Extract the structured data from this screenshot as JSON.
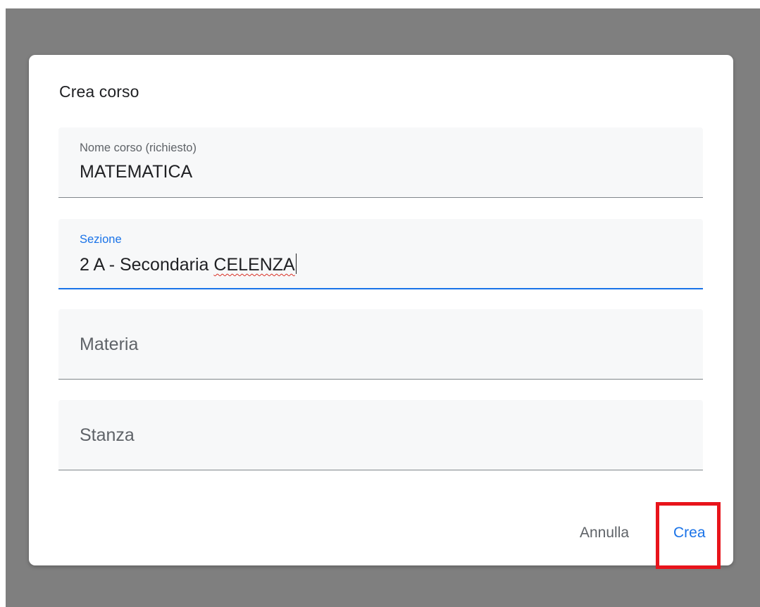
{
  "dialog": {
    "title": "Crea corso",
    "fields": {
      "course_name": {
        "label": "Nome corso (richiesto)",
        "value": "MATEMATICA"
      },
      "section": {
        "label": "Sezione",
        "value_plain": "2 A - Secondaria ",
        "value_misspelled": "CELENZA"
      },
      "subject": {
        "placeholder": "Materia"
      },
      "room": {
        "placeholder": "Stanza"
      }
    },
    "buttons": {
      "cancel_label": "Annulla",
      "create_label": "Crea"
    }
  },
  "colors": {
    "backdrop": "#7f7f7f",
    "accent": "#1a73e8",
    "highlight": "#e8141b"
  }
}
